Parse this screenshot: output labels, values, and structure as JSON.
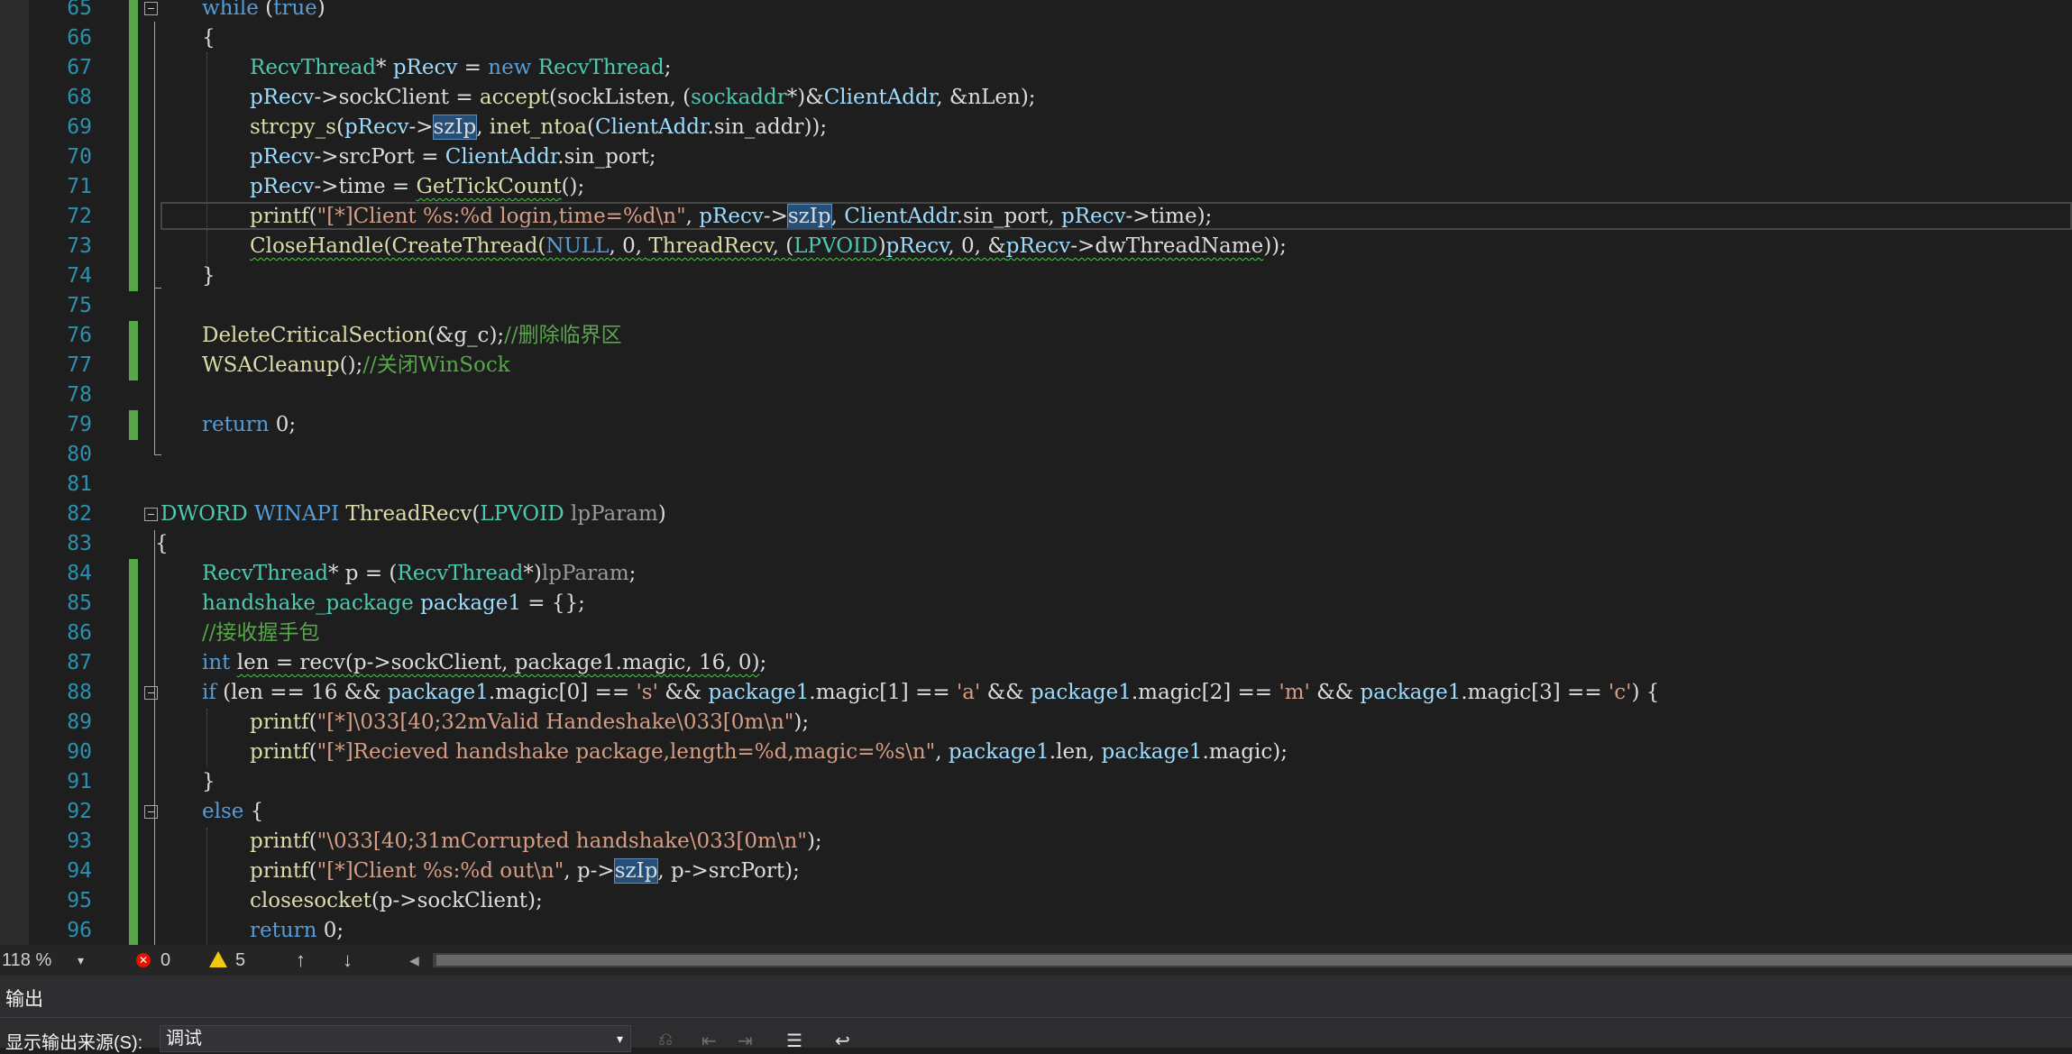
{
  "editor": {
    "lines": [
      {
        "n": "65",
        "tokens": [
          [
            "while",
            "#569cd6"
          ],
          [
            " (",
            "#dcdcdc"
          ],
          [
            "true",
            "#569cd6"
          ],
          [
            ")",
            "#dcdcdc"
          ]
        ]
      },
      {
        "n": "66",
        "tokens": [
          [
            "{",
            "#dcdcdc"
          ]
        ]
      },
      {
        "n": "67",
        "tokens": [
          [
            "RecvThread",
            "#4ec9b0"
          ],
          [
            "* ",
            "#dcdcdc"
          ],
          [
            "pRecv",
            "#9cdcfe"
          ],
          [
            " = ",
            "#dcdcdc"
          ],
          [
            "new",
            "#569cd6"
          ],
          [
            " ",
            "#dcdcdc"
          ],
          [
            "RecvThread",
            "#4ec9b0"
          ],
          [
            ";",
            "#dcdcdc"
          ]
        ]
      },
      {
        "n": "68",
        "tokens": [
          [
            "pRecv",
            "#9cdcfe"
          ],
          [
            "->sockClient = ",
            "#dcdcdc"
          ],
          [
            "accept",
            "#dcdcaa"
          ],
          [
            "(sockListen, (",
            "#dcdcdc"
          ],
          [
            "sockaddr",
            "#4ec9b0"
          ],
          [
            "*)&",
            "#dcdcdc"
          ],
          [
            "ClientAddr",
            "#9cdcfe"
          ],
          [
            ", &nLen);",
            "#dcdcdc"
          ]
        ]
      },
      {
        "n": "69",
        "tokens": [
          [
            "strcpy_s",
            "#dcdcaa"
          ],
          [
            "(",
            "#dcdcdc"
          ],
          [
            "pRecv",
            "#9cdcfe"
          ],
          [
            "->",
            "#dcdcdc"
          ],
          [
            "szIp",
            "#dcdcdc",
            "hl"
          ],
          [
            ", ",
            "#dcdcdc"
          ],
          [
            "inet_ntoa",
            "#dcdcaa"
          ],
          [
            "(",
            "#dcdcdc"
          ],
          [
            "ClientAddr",
            "#9cdcfe"
          ],
          [
            ".sin_addr));",
            "#dcdcdc"
          ]
        ]
      },
      {
        "n": "70",
        "tokens": [
          [
            "pRecv",
            "#9cdcfe"
          ],
          [
            "->srcPort = ",
            "#dcdcdc"
          ],
          [
            "ClientAddr",
            "#9cdcfe"
          ],
          [
            ".sin_port;",
            "#dcdcdc"
          ]
        ]
      },
      {
        "n": "71",
        "tokens": [
          [
            "pRecv",
            "#9cdcfe"
          ],
          [
            "->time = ",
            "#dcdcdc"
          ],
          [
            "GetTickCount",
            "#dcdcaa",
            "sq"
          ],
          [
            "();",
            "#dcdcdc"
          ]
        ]
      },
      {
        "n": "72",
        "tokens": [
          [
            "printf",
            "#dcdcaa"
          ],
          [
            "(",
            "#dcdcdc"
          ],
          [
            "\"[*]Client %s:%d login,time=%d\\n\"",
            "#d69d85"
          ],
          [
            ", ",
            "#dcdcdc"
          ],
          [
            "pRecv",
            "#9cdcfe"
          ],
          [
            "->",
            "#dcdcdc"
          ],
          [
            "szIp",
            "#dcdcdc",
            "hl"
          ],
          [
            ", ",
            "#dcdcdc"
          ],
          [
            "ClientAddr",
            "#9cdcfe"
          ],
          [
            ".sin_port, ",
            "#dcdcdc"
          ],
          [
            "pRecv",
            "#9cdcfe"
          ],
          [
            "->time);",
            "#dcdcdc"
          ]
        ]
      },
      {
        "n": "73",
        "tokens": [
          [
            "CloseHandle(CreateThread(",
            "#dcdcaa",
            "sq"
          ],
          [
            "NULL",
            "#569cd6",
            "sq"
          ],
          [
            ", 0, ",
            "#dcdcdc",
            "sq"
          ],
          [
            "ThreadRecv",
            "#dcdcaa",
            "sq"
          ],
          [
            ", (",
            "#dcdcdc",
            "sq"
          ],
          [
            "LPVOID",
            "#4ec9b0",
            "sq"
          ],
          [
            ")",
            "#dcdcdc",
            "sq"
          ],
          [
            "pRecv",
            "#9cdcfe",
            "sq"
          ],
          [
            ", 0, &",
            "#dcdcdc",
            "sq"
          ],
          [
            "pRecv",
            "#9cdcfe",
            "sq"
          ],
          [
            "->dwThreadName",
            "#dcdcdc",
            "sq"
          ],
          [
            "));",
            "#dcdcdc"
          ]
        ]
      },
      {
        "n": "74",
        "tokens": [
          [
            "}",
            "#dcdcdc"
          ]
        ]
      },
      {
        "n": "75",
        "tokens": []
      },
      {
        "n": "76",
        "tokens": [
          [
            "DeleteCriticalSection",
            "#dcdcaa"
          ],
          [
            "(&g_c);",
            "#dcdcdc"
          ],
          [
            "//删除临界区",
            "#57a64a"
          ]
        ]
      },
      {
        "n": "77",
        "tokens": [
          [
            "WSACleanup",
            "#dcdcaa"
          ],
          [
            "();",
            "#dcdcdc"
          ],
          [
            "//关闭WinSock",
            "#57a64a"
          ]
        ]
      },
      {
        "n": "78",
        "tokens": []
      },
      {
        "n": "79",
        "tokens": [
          [
            "return",
            "#569cd6"
          ],
          [
            " 0;",
            "#dcdcdc"
          ]
        ]
      },
      {
        "n": "80",
        "tokens": []
      },
      {
        "n": "81",
        "tokens": []
      },
      {
        "n": "82",
        "tokens": [
          [
            "DWORD",
            "#4ec9b0"
          ],
          [
            " ",
            "#dcdcdc"
          ],
          [
            "WINAPI",
            "#569cd6"
          ],
          [
            " ",
            "#dcdcdc"
          ],
          [
            "ThreadRecv",
            "#dcdcaa"
          ],
          [
            "(",
            "#dcdcdc"
          ],
          [
            "LPVOID",
            "#4ec9b0"
          ],
          [
            " ",
            "#dcdcdc"
          ],
          [
            "lpParam",
            "#9a9a9a"
          ],
          [
            ")",
            "#dcdcdc"
          ]
        ]
      },
      {
        "n": "83",
        "tokens": [
          [
            "{",
            "#dcdcdc"
          ]
        ]
      },
      {
        "n": "84",
        "tokens": [
          [
            "RecvThread",
            "#4ec9b0"
          ],
          [
            "* p = (",
            "#dcdcdc"
          ],
          [
            "RecvThread",
            "#4ec9b0"
          ],
          [
            "*)",
            "#dcdcdc"
          ],
          [
            "lpParam",
            "#9a9a9a"
          ],
          [
            ";",
            "#dcdcdc"
          ]
        ]
      },
      {
        "n": "85",
        "tokens": [
          [
            "handshake_package",
            "#4ec9b0"
          ],
          [
            " ",
            "#dcdcdc"
          ],
          [
            "package1",
            "#9cdcfe"
          ],
          [
            " = {};",
            "#dcdcdc"
          ]
        ]
      },
      {
        "n": "86",
        "tokens": [
          [
            "//接收握手包",
            "#57a64a"
          ]
        ]
      },
      {
        "n": "87",
        "tokens": [
          [
            "int",
            "#569cd6"
          ],
          [
            " ",
            "#dcdcdc"
          ],
          [
            "len = recv(p->sockClient, package1.magic, 16, 0)",
            "#dcdcdc",
            "sq"
          ],
          [
            ";",
            "#dcdcdc"
          ]
        ]
      },
      {
        "n": "88",
        "tokens": [
          [
            "if",
            "#569cd6"
          ],
          [
            " (len == 16 && ",
            "#dcdcdc"
          ],
          [
            "package1",
            "#9cdcfe"
          ],
          [
            ".magic[0] == ",
            "#dcdcdc"
          ],
          [
            "'s'",
            "#d69d85"
          ],
          [
            " && ",
            "#dcdcdc"
          ],
          [
            "package1",
            "#9cdcfe"
          ],
          [
            ".magic[1] == ",
            "#dcdcdc"
          ],
          [
            "'a'",
            "#d69d85"
          ],
          [
            " && ",
            "#dcdcdc"
          ],
          [
            "package1",
            "#9cdcfe"
          ],
          [
            ".magic[2] == ",
            "#dcdcdc"
          ],
          [
            "'m'",
            "#d69d85"
          ],
          [
            " && ",
            "#dcdcdc"
          ],
          [
            "package1",
            "#9cdcfe"
          ],
          [
            ".magic[3] == ",
            "#dcdcdc"
          ],
          [
            "'c'",
            "#d69d85"
          ],
          [
            ") {",
            "#dcdcdc"
          ]
        ]
      },
      {
        "n": "89",
        "tokens": [
          [
            "printf",
            "#dcdcaa"
          ],
          [
            "(",
            "#dcdcdc"
          ],
          [
            "\"[*]\\033[40;32mValid Handeshake\\033[0m\\n\"",
            "#d69d85"
          ],
          [
            ");",
            "#dcdcdc"
          ]
        ]
      },
      {
        "n": "90",
        "tokens": [
          [
            "printf",
            "#dcdcaa"
          ],
          [
            "(",
            "#dcdcdc"
          ],
          [
            "\"[*]Recieved handshake package,length=%d,magic=%s\\n\"",
            "#d69d85"
          ],
          [
            ", ",
            "#dcdcdc"
          ],
          [
            "package1",
            "#9cdcfe"
          ],
          [
            ".len, ",
            "#dcdcdc"
          ],
          [
            "package1",
            "#9cdcfe"
          ],
          [
            ".magic);",
            "#dcdcdc"
          ]
        ]
      },
      {
        "n": "91",
        "tokens": [
          [
            "}",
            "#dcdcdc"
          ]
        ]
      },
      {
        "n": "92",
        "tokens": [
          [
            "else",
            "#569cd6"
          ],
          [
            " {",
            "#dcdcdc"
          ]
        ]
      },
      {
        "n": "93",
        "tokens": [
          [
            "printf",
            "#dcdcaa"
          ],
          [
            "(",
            "#dcdcdc"
          ],
          [
            "\"\\033[40;31mCorrupted handshake\\033[0m\\n\"",
            "#d69d85"
          ],
          [
            ");",
            "#dcdcdc"
          ]
        ]
      },
      {
        "n": "94",
        "tokens": [
          [
            "printf",
            "#dcdcaa"
          ],
          [
            "(",
            "#dcdcdc"
          ],
          [
            "\"[*]Client %s:%d out\\n\"",
            "#d69d85"
          ],
          [
            ", p->",
            "#dcdcdc"
          ],
          [
            "szIp",
            "#dcdcdc",
            "hl"
          ],
          [
            ", p->srcPort);",
            "#dcdcdc"
          ]
        ]
      },
      {
        "n": "95",
        "tokens": [
          [
            "closesocket",
            "#dcdcaa"
          ],
          [
            "(p->sockClient);",
            "#dcdcdc"
          ]
        ]
      },
      {
        "n": "96",
        "tokens": [
          [
            "return",
            "#569cd6"
          ],
          [
            " 0;",
            "#dcdcdc"
          ]
        ]
      }
    ]
  },
  "status": {
    "zoom": "118 %",
    "errors": "0",
    "warnings": "5",
    "up_arrow": "↑",
    "down_arrow": "↓",
    "scroll_left": "◀",
    "zoom_dropdown": "▾"
  },
  "output": {
    "title": "输出",
    "source_label": "显示输出来源(S):",
    "source_value": "调试",
    "dropdown_arrow": "▾"
  }
}
